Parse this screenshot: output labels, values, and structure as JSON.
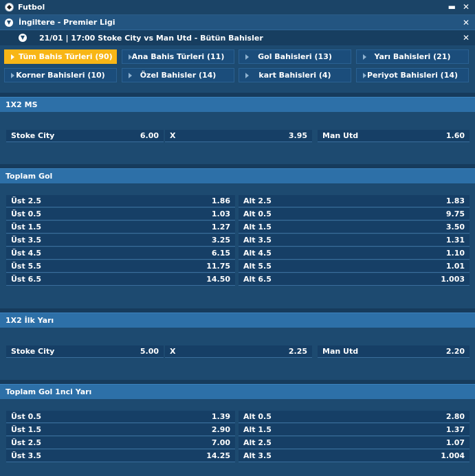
{
  "header": {
    "title": "Futbol",
    "minimize_glyph": "▬",
    "close_glyph": "✕"
  },
  "league": {
    "title": "İngiltere - Premier Ligi",
    "close_glyph": "✕"
  },
  "match": {
    "title": "21/01 | 17:00 Stoke City vs Man Utd - Bütün Bahisler",
    "close_glyph": "✕"
  },
  "tabs": [
    {
      "label": "Tüm Bahis Türleri (90)",
      "active": true
    },
    {
      "label": "Ana Bahis Türleri (11)"
    },
    {
      "label": "Gol Bahisleri (13)"
    },
    {
      "label": "Yarı Bahisleri (21)"
    },
    {
      "label": "Korner Bahisleri (10)"
    },
    {
      "label": "Özel Bahisler (14)"
    },
    {
      "label": "kart Bahisleri (4)"
    },
    {
      "label": "Periyot Bahisleri (14)"
    }
  ],
  "sections": [
    {
      "title": "1X2 MS",
      "rows": [
        [
          {
            "name": "Stoke City",
            "odd": "6.00"
          },
          {
            "name": "X",
            "odd": "3.95"
          },
          {
            "name": "Man Utd",
            "odd": "1.60"
          }
        ]
      ]
    },
    {
      "title": "Toplam Gol",
      "rows": [
        [
          {
            "name": "Üst 2.5",
            "odd": "1.86"
          },
          {
            "name": "Alt 2.5",
            "odd": "1.83"
          }
        ],
        [
          {
            "name": "Üst 0.5",
            "odd": "1.03"
          },
          {
            "name": "Alt 0.5",
            "odd": "9.75"
          }
        ],
        [
          {
            "name": "Üst 1.5",
            "odd": "1.27"
          },
          {
            "name": "Alt 1.5",
            "odd": "3.50"
          }
        ],
        [
          {
            "name": "Üst 3.5",
            "odd": "3.25"
          },
          {
            "name": "Alt 3.5",
            "odd": "1.31"
          }
        ],
        [
          {
            "name": "Üst 4.5",
            "odd": "6.15"
          },
          {
            "name": "Alt 4.5",
            "odd": "1.10"
          }
        ],
        [
          {
            "name": "Üst 5.5",
            "odd": "11.75"
          },
          {
            "name": "Alt 5.5",
            "odd": "1.01"
          }
        ],
        [
          {
            "name": "Üst 6.5",
            "odd": "14.50"
          },
          {
            "name": "Alt 6.5",
            "odd": "1.003"
          }
        ]
      ]
    },
    {
      "title": "1X2 İlk Yarı",
      "rows": [
        [
          {
            "name": "Stoke City",
            "odd": "5.00"
          },
          {
            "name": "X",
            "odd": "2.25"
          },
          {
            "name": "Man Utd",
            "odd": "2.20"
          }
        ]
      ]
    },
    {
      "title": "Toplam Gol 1nci Yarı",
      "rows": [
        [
          {
            "name": "Üst 0.5",
            "odd": "1.39"
          },
          {
            "name": "Alt 0.5",
            "odd": "2.80"
          }
        ],
        [
          {
            "name": "Üst 1.5",
            "odd": "2.90"
          },
          {
            "name": "Alt 1.5",
            "odd": "1.37"
          }
        ],
        [
          {
            "name": "Üst 2.5",
            "odd": "7.00"
          },
          {
            "name": "Alt 2.5",
            "odd": "1.07"
          }
        ],
        [
          {
            "name": "Üst 3.5",
            "odd": "14.25"
          },
          {
            "name": "Alt 3.5",
            "odd": "1.004"
          }
        ]
      ]
    }
  ]
}
